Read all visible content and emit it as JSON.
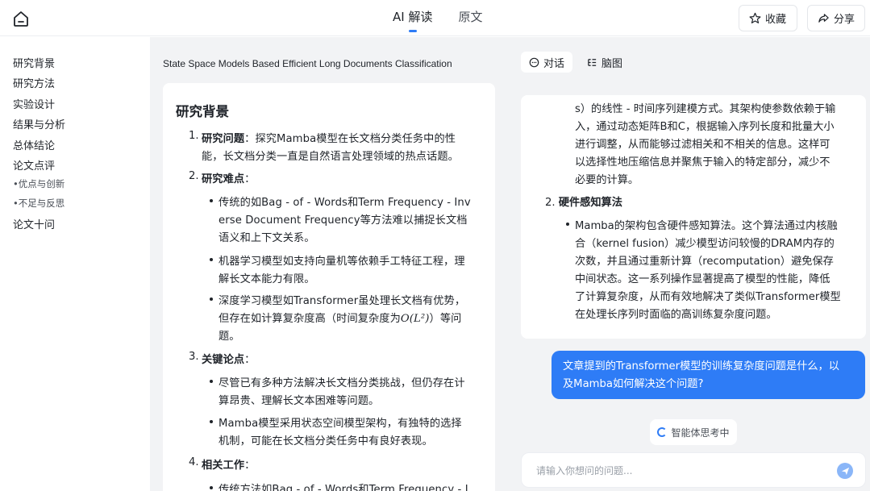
{
  "header": {
    "tabs": [
      {
        "label": "AI 解读",
        "active": true
      },
      {
        "label": "原文",
        "active": false
      }
    ],
    "favorite_label": "收藏",
    "share_label": "分享"
  },
  "outline": {
    "items": [
      {
        "label": "研究背景"
      },
      {
        "label": "研究方法"
      },
      {
        "label": "实验设计"
      },
      {
        "label": "结果与分析"
      },
      {
        "label": "总体结论"
      },
      {
        "label": "论文点评"
      },
      {
        "label": "•优点与创新"
      },
      {
        "label": "•不足与反思"
      },
      {
        "label": "论文十问"
      }
    ]
  },
  "paper": {
    "title": "State Space Models Based Efficient Long Documents Classification",
    "section_title": "研究背景",
    "s1_num": "1.",
    "s1_head": "研究问题",
    "s1_colon": "：",
    "s1_l1": "探究Mamba模型在长文档分类任务中的性",
    "s1_l2": "能，长文档分类一直是自然语言处理领域的热点话题。",
    "s2_num": "2.",
    "s2_head": "研究难点",
    "s2_colon": "：",
    "s2_b1_l1": "传统的如Bag - of - Words和Term Frequency - Inv",
    "s2_b1_l2": "erse Document Frequency等方法难以捕捉长文档",
    "s2_b1_l3": "语义和上下文关系。",
    "s2_b2_l1": "机器学习模型如支持向量机等依赖手工特征工程，理",
    "s2_b2_l2": "解长文本能力有限。",
    "s2_b3_l1": "深度学习模型如Transformer虽处理长文档有优势，",
    "s2_b3_l2a": "但存在如计算复杂度高（时间复杂度为",
    "s2_b3_math": "O(L²)",
    "s2_b3_l2b": "）等问",
    "s2_b3_l3": "题。",
    "s3_num": "3.",
    "s3_head": "关键论点",
    "s3_colon": "：",
    "s3_b1_l1": "尽管已有多种方法解决长文档分类挑战，但仍存在计",
    "s3_b1_l2": "算昂贵、理解长文本困难等问题。",
    "s3_b2_l1": "Mamba模型采用状态空间模型架构，有独特的选择",
    "s3_b2_l2": "机制，可能在长文档分类任务中有良好表现。",
    "s4_num": "4.",
    "s4_head": "相关工作",
    "s4_colon": "：",
    "s4_b1_l1": "传统方法如Bag - of - Words和Term Frequency - I"
  },
  "chat": {
    "tab_dialog": "对话",
    "tab_mindmap": "脑图",
    "answer": {
      "p1_l1": "s）的线性 - 时间序列建模方式。其架构使参数依赖于输",
      "p1_l2": "入，通过动态矩阵B和C，根据输入序列长度和批量大小",
      "p1_l3": "进行调整，从而能够过滤相关和不相关的信息。这样可",
      "p1_l4": "以选择性地压缩信息并聚焦于输入的特定部分，减少不",
      "p1_l5": "必要的计算。",
      "h2_num": "2.",
      "h2": "硬件感知算法",
      "b_l1": "Mamba的架构包含硬件感知算法。这个算法通过内核融",
      "b_l2": "合（kernel fusion）减少模型访问较慢的DRAM内存的",
      "b_l3": "次数，并且通过重新计算（recomputation）避免保存",
      "b_l4": "中间状态。这一系列操作显著提高了模型的性能，降低",
      "b_l5": "了计算复杂度，从而有效地解决了类似Transformer模型",
      "b_l6": "在处理长序列时面临的高训练复杂度问题。"
    },
    "question_l1": "文章提到的Transformer模型的训练复杂度问题是什么，以",
    "question_l2": "及Mamba如何解决这个问题?",
    "thinking_label": "智能体思考中",
    "input_placeholder": "请输入你想问的问题..."
  },
  "colors": {
    "accent": "#2e7cf6",
    "panel_bg": "#f2f3f5"
  },
  "icons": [
    "home-icon",
    "star-icon",
    "share-icon",
    "chat-icon",
    "mindmap-icon",
    "spinner-icon",
    "send-icon"
  ]
}
